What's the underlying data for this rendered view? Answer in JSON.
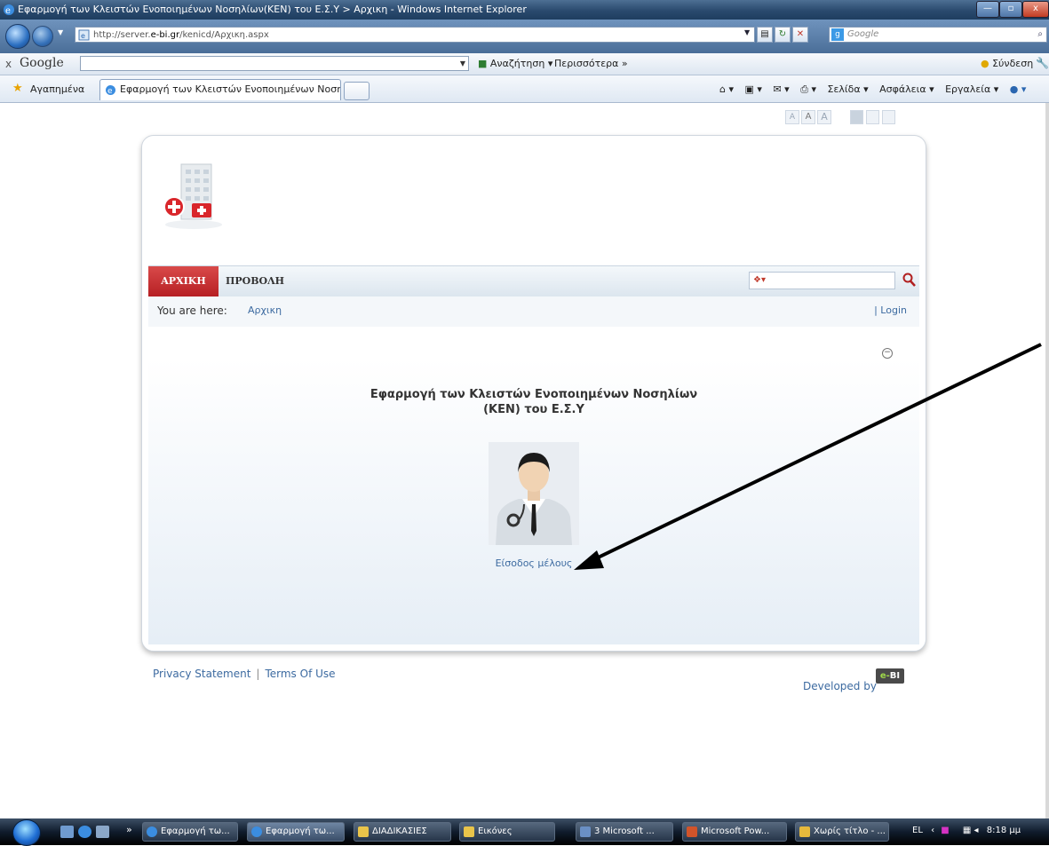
{
  "window": {
    "title": "Εφαρμογή των Κλειστών Ενοποιημένων Νοσηλίων(ΚΕΝ) του Ε.Σ.Υ > Αρχικη - Windows Internet Explorer"
  },
  "address_bar": {
    "url_prefix": "http://server.",
    "url_host": "e-bi.gr",
    "url_path": "/kenicd/Αρχικη.aspx",
    "search_placeholder": "Google"
  },
  "google_toolbar": {
    "close": "x",
    "logo": "Google",
    "search_label": "Αναζήτηση ▾",
    "more_label": "Περισσότερα »",
    "login_label": "Σύνδεση"
  },
  "favorites_bar": {
    "favorites_label": "Αγαπημένα",
    "tab_title": "Εφαρμογή των Κλειστών Ενοποιημένων Νοσηλί...",
    "commands": [
      "Σελίδα ▾",
      "Ασφάλεια ▾",
      "Εργαλεία ▾"
    ]
  },
  "page": {
    "font_sizes": [
      "A",
      "A",
      "A"
    ],
    "menu": {
      "home": "ΑΡΧΙΚΗ",
      "view": "ΠΡΟΒΟΛΗ"
    },
    "breadcrumb": {
      "label": "You are here:",
      "current": "Αρχικη"
    },
    "login": "| Login",
    "app_title_line1": "Εφαρμογή των Κλειστών Ενοποιημένων Νοσηλίων",
    "app_title_line2": "(ΚΕΝ) του Ε.Σ.Υ",
    "member_login": "Είσοδος μέλους",
    "collapse": "−",
    "footer": {
      "privacy": "Privacy Statement",
      "separator": "|",
      "terms": "Terms Of Use",
      "developed_by": "Developed by",
      "badge_e": "e-",
      "badge_rest": "BI"
    }
  },
  "taskbar": {
    "buttons": [
      "Εφαρμογή τω...",
      "Εφαρμογή τω...",
      "ΔΙΑΔΙΚΑΣΙΕΣ",
      "Εικόνες",
      "3 Microsoft ...",
      "Microsoft Pow...",
      "Χωρίς τίτλο - ..."
    ],
    "language": "EL",
    "clock": "8:18 μμ"
  }
}
